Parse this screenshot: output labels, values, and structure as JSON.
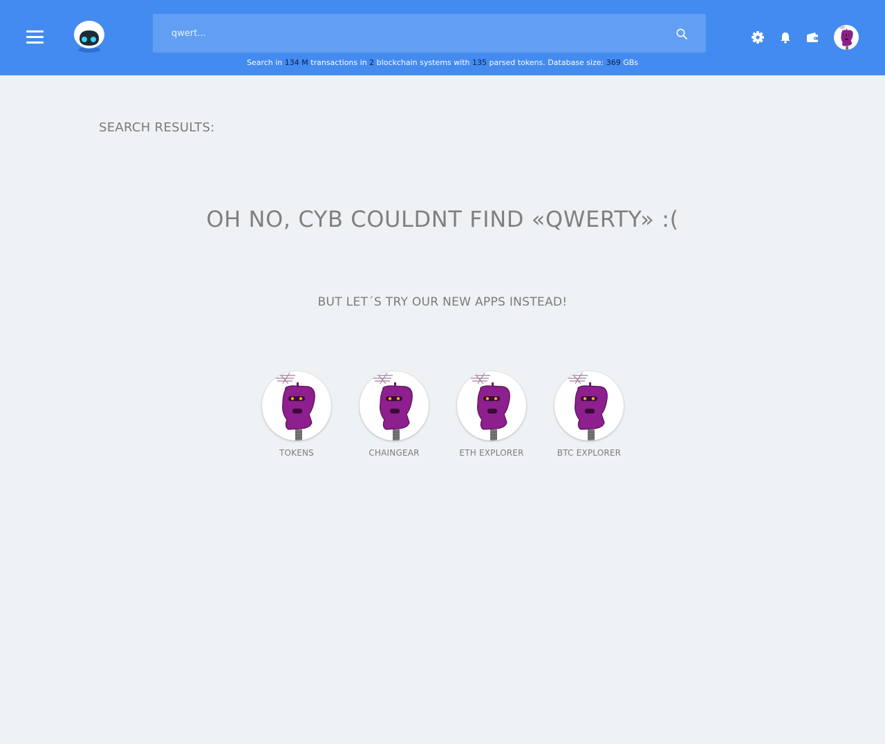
{
  "header": {
    "search": {
      "value": "",
      "placeholder": "qwert..."
    },
    "stats": {
      "t1": "Search in",
      "transactions": "134 M",
      "t2": "transactions in",
      "blockchains": "2",
      "t3": "blockchain systems with",
      "tokens": "135",
      "t4": "parsed tokens. Database size:",
      "db_size": "369",
      "t5": "GBs"
    }
  },
  "main": {
    "results_title": "SEARCH RESULTS:",
    "not_found": "OH NO, CYB COULDNT FIND «QWERTY» :(",
    "suggestion": "BUT LET´S TRY OUR NEW APPS INSTEAD!",
    "apps": [
      {
        "label": "TOKENS"
      },
      {
        "label": "CHAINGEAR"
      },
      {
        "label": "ETH EXPLORER"
      },
      {
        "label": "BTC EXPLORER"
      }
    ]
  },
  "colors": {
    "header_bg": "#438bf0",
    "search_bg": "#629ff2",
    "page_bg": "#eef2f5",
    "stat_number": "#0b1e4a",
    "robot_purple": "#8e1f8e"
  },
  "icons": [
    "menu-icon",
    "cyb-logo-icon",
    "search-icon",
    "settings-icon",
    "bell-icon",
    "wallet-icon",
    "robot-avatar-icon"
  ]
}
